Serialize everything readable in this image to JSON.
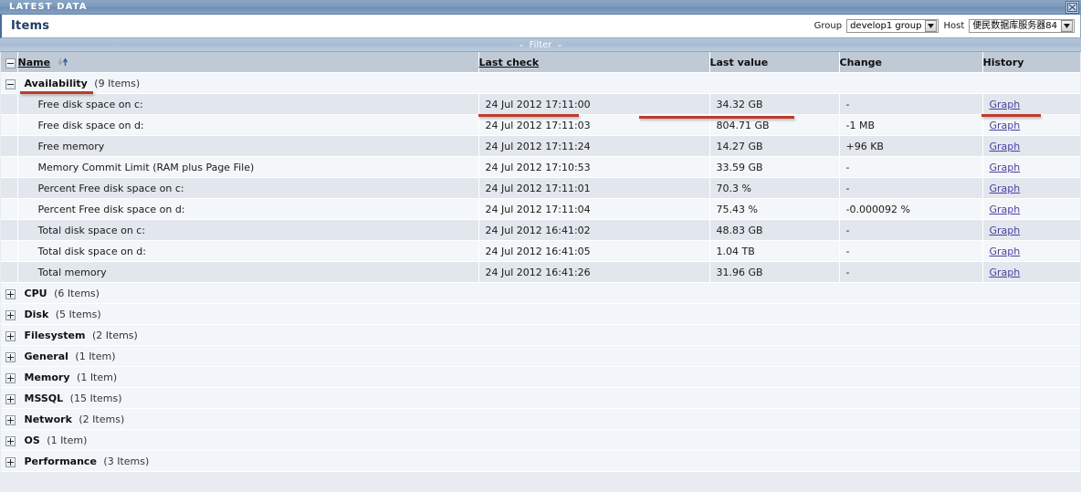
{
  "window": {
    "title": "LATEST DATA",
    "maximize_icon": "maximize-icon"
  },
  "header": {
    "page_title": "Items",
    "group_label": "Group",
    "group_value": "develop1 group",
    "host_label": "Host",
    "host_value": "便民数据库服务器84",
    "dropdown_icon": "chevron-down-icon"
  },
  "filter": {
    "label": "Filter",
    "left_icon": "double-chevron-down-icon",
    "right_icon": "double-chevron-down-icon"
  },
  "table": {
    "columns": [
      {
        "key": "check",
        "label": ""
      },
      {
        "key": "name",
        "label": "Name"
      },
      {
        "key": "last",
        "label": "Last check"
      },
      {
        "key": "value",
        "label": "Last value"
      },
      {
        "key": "change",
        "label": "Change"
      },
      {
        "key": "hist",
        "label": "History"
      }
    ],
    "sort_icon_down": "sort-descending-icon",
    "sort_icon_up": "sort-ascending-icon",
    "expanded_group": {
      "toggle_icon": "collapse-icon",
      "name": "Availability",
      "count": "(9 Items)"
    },
    "rows": [
      {
        "name": "Free disk space on c:",
        "last": "24 Jul 2012 17:11:00",
        "value": "34.32 GB",
        "change": "-",
        "history": "Graph"
      },
      {
        "name": "Free disk space on d:",
        "last": "24 Jul 2012 17:11:03",
        "value": "804.71 GB",
        "change": "-1 MB",
        "history": "Graph"
      },
      {
        "name": "Free memory",
        "last": "24 Jul 2012 17:11:24",
        "value": "14.27 GB",
        "change": "+96 KB",
        "history": "Graph"
      },
      {
        "name": "Memory Commit Limit (RAM plus Page File)",
        "last": "24 Jul 2012 17:10:53",
        "value": "33.59 GB",
        "change": "-",
        "history": "Graph"
      },
      {
        "name": "Percent Free disk space on c:",
        "last": "24 Jul 2012 17:11:01",
        "value": "70.3 %",
        "change": "-",
        "history": "Graph"
      },
      {
        "name": "Percent Free disk space on d:",
        "last": "24 Jul 2012 17:11:04",
        "value": "75.43 %",
        "change": "-0.000092 %",
        "history": "Graph"
      },
      {
        "name": "Total disk space on c:",
        "last": "24 Jul 2012 16:41:02",
        "value": "48.83 GB",
        "change": "-",
        "history": "Graph"
      },
      {
        "name": "Total disk space on d:",
        "last": "24 Jul 2012 16:41:05",
        "value": "1.04 TB",
        "change": "-",
        "history": "Graph"
      },
      {
        "name": "Total memory",
        "last": "24 Jul 2012 16:41:26",
        "value": "31.96 GB",
        "change": "-",
        "history": "Graph"
      }
    ],
    "collapsed_groups": [
      {
        "toggle_icon": "expand-icon",
        "name": "CPU",
        "count": "(6 Items)"
      },
      {
        "toggle_icon": "expand-icon",
        "name": "Disk",
        "count": "(5 Items)"
      },
      {
        "toggle_icon": "expand-icon",
        "name": "Filesystem",
        "count": "(2 Items)"
      },
      {
        "toggle_icon": "expand-icon",
        "name": "General",
        "count": "(1 Item)"
      },
      {
        "toggle_icon": "expand-icon",
        "name": "Memory",
        "count": "(1 Item)"
      },
      {
        "toggle_icon": "expand-icon",
        "name": "MSSQL",
        "count": "(15 Items)"
      },
      {
        "toggle_icon": "expand-icon",
        "name": "Network",
        "count": "(2 Items)"
      },
      {
        "toggle_icon": "expand-icon",
        "name": "OS",
        "count": "(1 Item)"
      },
      {
        "toggle_icon": "expand-icon",
        "name": "Performance",
        "count": "(3 Items)"
      }
    ]
  },
  "colors": {
    "titlebar": "#7d9bbd",
    "table_header": "#bfcad6",
    "row_odd": "#e2e7ee",
    "row_even": "#f4f7fa",
    "group_row": "#f2f6fa",
    "link": "#4a3f9e",
    "annotation": "#c0392b",
    "title_text": "#1f3d66"
  }
}
